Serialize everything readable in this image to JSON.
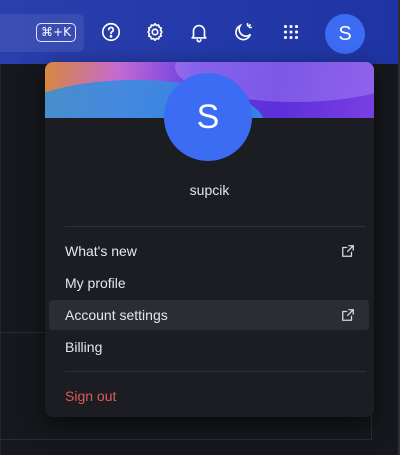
{
  "topbar": {
    "shortcut": "⌘+K",
    "icons": [
      "help-icon",
      "settings-icon",
      "notifications-icon",
      "theme-toggle-icon",
      "apps-grid-icon"
    ],
    "avatar_initial": "S"
  },
  "menu": {
    "avatar_initial": "S",
    "username": "supcik",
    "items": [
      {
        "label": "What's new",
        "external": true
      },
      {
        "label": "My profile",
        "external": false
      },
      {
        "label": "Account settings",
        "external": true,
        "highlighted": true
      },
      {
        "label": "Billing",
        "external": false
      }
    ],
    "signout_label": "Sign out"
  },
  "colors": {
    "topbar": "#2a3fae",
    "avatar": "#3b6cf3",
    "signout": "#e0595b",
    "menu_bg": "#1b1d22"
  }
}
